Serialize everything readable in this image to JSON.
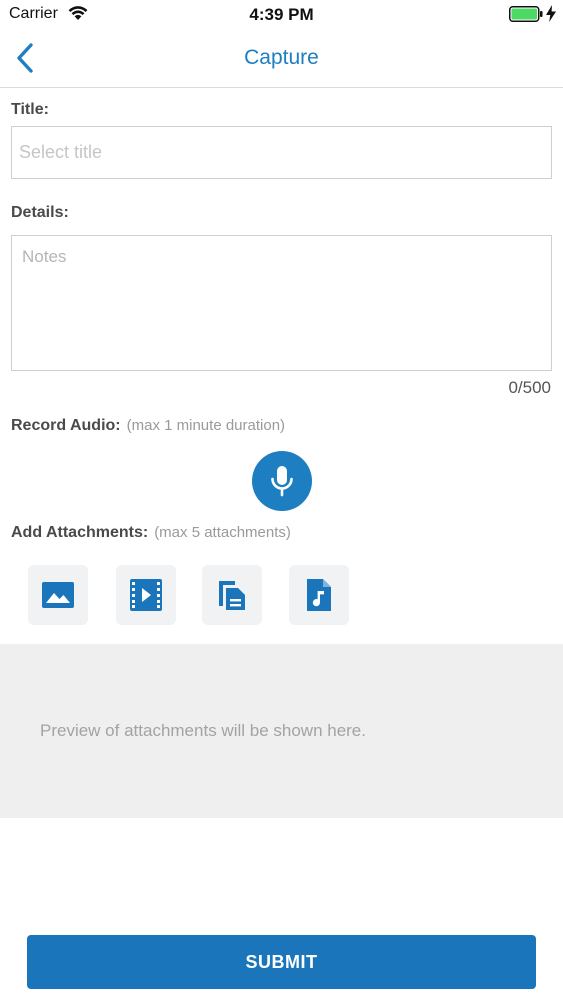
{
  "status_bar": {
    "carrier": "Carrier",
    "time": "4:39 PM",
    "battery_color": "#4cd964"
  },
  "nav": {
    "title": "Capture",
    "back_icon": "chevron-left-icon",
    "accent_color": "#1d7fc1"
  },
  "form": {
    "title_label": "Title:",
    "title_placeholder": "Select title",
    "title_value": "",
    "details_label": "Details:",
    "notes_placeholder": "Notes",
    "notes_value": "",
    "char_count": "0/500"
  },
  "audio": {
    "label": "Record Audio:",
    "hint": "(max 1 minute duration)",
    "icon": "microphone-icon"
  },
  "attachments": {
    "label": "Add Attachments:",
    "hint": "(max 5 attachments)",
    "buttons": [
      {
        "icon": "image-icon"
      },
      {
        "icon": "video-icon"
      },
      {
        "icon": "document-icon"
      },
      {
        "icon": "audio-file-icon"
      }
    ]
  },
  "preview": {
    "text": "Preview of attachments will be shown here."
  },
  "submit": {
    "label": "SUBMIT",
    "color": "#1a75bb"
  }
}
